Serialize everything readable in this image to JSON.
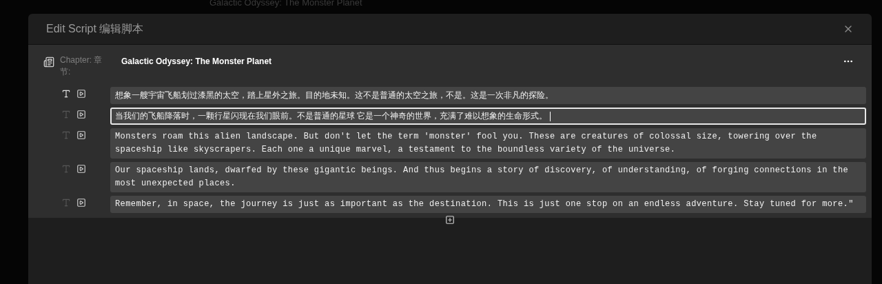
{
  "background_title": "Galactic Odyssey: The Monster Planet",
  "dialog": {
    "title": "Edit Script 编辑脚本"
  },
  "chapter": {
    "label": "Chapter: 章节:",
    "value": "Galactic Odyssey: The Monster Planet"
  },
  "lines": [
    {
      "kind": "chinese",
      "text": "想象一艘宇宙飞船划过漆黑的太空，踏上星外之旅。目的地未知。这不是普通的太空之旅，不是。这是一次非凡的探险。",
      "text_mode": true,
      "selected": false
    },
    {
      "kind": "chinese",
      "text": "当我们的飞船降落时，一颗行星闪现在我们眼前。不是普通的星球  它是一个神奇的世界，充满了难以想象的生命形式。",
      "text_mode": false,
      "selected": true
    },
    {
      "kind": "english",
      "text": "Monsters roam this alien landscape. But don't let the term 'monster' fool you. These are creatures of colossal size, towering over the spaceship like skyscrapers. Each one a unique marvel, a testament to the boundless variety of the universe.",
      "text_mode": false,
      "selected": false
    },
    {
      "kind": "english",
      "text": "Our spaceship lands, dwarfed by these gigantic beings. And thus begins a story of discovery, of understanding, of forging connections in the most unexpected places.",
      "text_mode": false,
      "selected": false
    },
    {
      "kind": "english",
      "text": "Remember, in space, the journey is just as important as the destination. This is just one stop on an endless adventure. Stay tuned for more.\"",
      "text_mode": false,
      "selected": false
    }
  ]
}
